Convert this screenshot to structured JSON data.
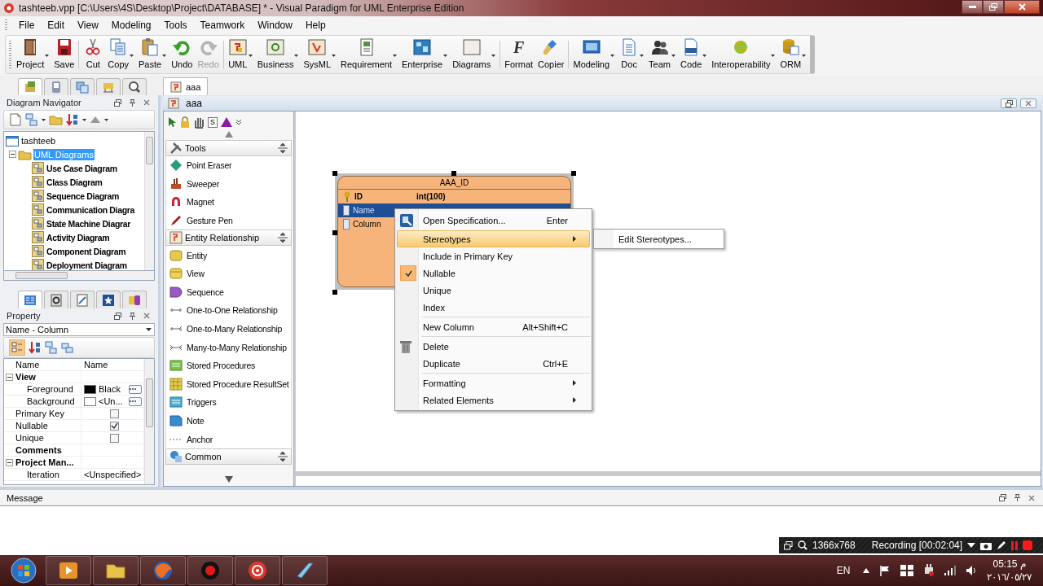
{
  "window": {
    "title": "tashteeb.vpp [C:\\Users\\4S\\Desktop\\Project\\DATABASE] * - Visual Paradigm for UML Enterprise Edition"
  },
  "menu": [
    "File",
    "Edit",
    "View",
    "Modeling",
    "Tools",
    "Teamwork",
    "Window",
    "Help"
  ],
  "toolbar": [
    {
      "kind": "button",
      "label": "Project",
      "dropdown": true,
      "disabled": false
    },
    {
      "kind": "button",
      "label": "Save",
      "dropdown": false,
      "disabled": false
    },
    {
      "kind": "separator"
    },
    {
      "kind": "button",
      "label": "Cut",
      "dropdown": false,
      "disabled": false
    },
    {
      "kind": "button",
      "label": "Copy",
      "dropdown": true,
      "disabled": false
    },
    {
      "kind": "button",
      "label": "Paste",
      "dropdown": true,
      "disabled": false
    },
    {
      "kind": "button",
      "label": "Undo",
      "dropdown": false,
      "disabled": false
    },
    {
      "kind": "button",
      "label": "Redo",
      "dropdown": false,
      "disabled": true
    },
    {
      "kind": "separator"
    },
    {
      "kind": "button",
      "label": "UML",
      "dropdown": true,
      "disabled": false
    },
    {
      "kind": "button",
      "label": "Business",
      "dropdown": true,
      "disabled": false
    },
    {
      "kind": "button",
      "label": "SysML",
      "dropdown": true,
      "disabled": false
    },
    {
      "kind": "button",
      "label": "Requirement",
      "dropdown": true,
      "disabled": false
    },
    {
      "kind": "button",
      "label": "Enterprise",
      "dropdown": true,
      "disabled": false
    },
    {
      "kind": "button",
      "label": "Diagrams",
      "dropdown": true,
      "disabled": false
    },
    {
      "kind": "separator"
    },
    {
      "kind": "button",
      "label": "Format",
      "glyph": "F",
      "dropdown": false,
      "disabled": false
    },
    {
      "kind": "button",
      "label": "Copier",
      "dropdown": false,
      "disabled": false
    },
    {
      "kind": "separator"
    },
    {
      "kind": "button",
      "label": "Modeling",
      "dropdown": true,
      "disabled": false
    },
    {
      "kind": "button",
      "label": "Doc",
      "dropdown": true,
      "disabled": false
    },
    {
      "kind": "button",
      "label": "Team",
      "dropdown": true,
      "disabled": false
    },
    {
      "kind": "button",
      "label": "Code",
      "dropdown": true,
      "disabled": false
    },
    {
      "kind": "button",
      "label": "Interoperability",
      "dropdown": true,
      "disabled": false
    },
    {
      "kind": "button",
      "label": "ORM",
      "dropdown": true,
      "disabled": false
    }
  ],
  "side_tabs": [
    {
      "selected": true
    },
    {
      "selected": false
    },
    {
      "selected": false
    },
    {
      "selected": false
    },
    {
      "selected": false
    }
  ],
  "document_tabs": [
    {
      "label": "aaa",
      "selected": true
    }
  ],
  "navigator": {
    "title": "Diagram Navigator",
    "tree": [
      {
        "label": "tashteeb",
        "selected": false,
        "children": [
          {
            "label": "UML Diagrams",
            "selected": true,
            "expanded": true,
            "children": [
              {
                "label": "Use Case Diagram",
                "selected": false
              },
              {
                "label": "Class Diagram",
                "selected": false
              },
              {
                "label": "Sequence Diagram",
                "selected": false
              },
              {
                "label": "Communication Diagra",
                "selected": false
              },
              {
                "label": "State Machine Diagrar",
                "selected": false
              },
              {
                "label": "Activity Diagram",
                "selected": false
              },
              {
                "label": "Component Diagram",
                "selected": false
              },
              {
                "label": "Deployment Diagram",
                "selected": false
              }
            ]
          }
        ]
      }
    ]
  },
  "bottom_tabs": [
    {
      "selected": true
    },
    {
      "selected": false
    },
    {
      "selected": false
    },
    {
      "selected": false
    },
    {
      "selected": false
    }
  ],
  "property": {
    "title": "Property",
    "selector": "Name - Column",
    "columns": [
      "Name",
      "Name"
    ],
    "rows": [
      {
        "kind": "group",
        "label": "View",
        "expanded": true,
        "children": [
          {
            "kind": "color",
            "label": "Foreground",
            "value": "Black",
            "color": "#000000"
          },
          {
            "kind": "color",
            "label": "Background",
            "value": "<Un...",
            "color": "#ffffff"
          }
        ]
      },
      {
        "kind": "checkbox",
        "label": "Primary Key",
        "checked": false
      },
      {
        "kind": "checkbox",
        "label": "Nullable",
        "checked": true
      },
      {
        "kind": "checkbox",
        "label": "Unique",
        "checked": false
      },
      {
        "kind": "heading",
        "label": "Comments"
      },
      {
        "kind": "group",
        "label": "Project Man...",
        "expanded": true,
        "children": [
          {
            "kind": "text",
            "label": "Iteration",
            "value": "<Unspecified>"
          }
        ]
      }
    ]
  },
  "diagram": {
    "title": "aaa"
  },
  "palette": {
    "tool_glyph": "S",
    "groups": [
      {
        "label": "Tools",
        "expanded": true,
        "items": [
          "Point Eraser",
          "Sweeper",
          "Magnet",
          "Gesture Pen"
        ]
      },
      {
        "label": "Entity Relationship",
        "expanded": true,
        "items": [
          "Entity",
          "View",
          "Sequence",
          "One-to-One Relationship",
          "One-to-Many Relationship",
          "Many-to-Many Relationship",
          "Stored Procedures",
          "Stored Procedure ResultSet",
          "Triggers",
          "Note",
          "Anchor"
        ]
      },
      {
        "label": "Common",
        "expanded": false
      }
    ]
  },
  "entity": {
    "name": "AAA_ID",
    "columns": [
      {
        "name": "ID",
        "type": "int(100)",
        "primary_key": true,
        "selected": false
      },
      {
        "name": "Name",
        "primary_key": false,
        "selected": true
      },
      {
        "name": "Column",
        "primary_key": false,
        "selected": false
      }
    ]
  },
  "context_menu": {
    "items": [
      {
        "kind": "item",
        "label": "Open Specification...",
        "shortcut": "Enter",
        "submenu": false,
        "selected": false,
        "checked": false
      },
      {
        "kind": "item",
        "label": "Stereotypes",
        "submenu": true,
        "selected": true,
        "checked": false
      },
      {
        "kind": "item",
        "label": "Include in Primary Key",
        "submenu": false,
        "selected": false,
        "checked": false
      },
      {
        "kind": "item",
        "label": "Nullable",
        "submenu": false,
        "selected": false,
        "checked": true
      },
      {
        "kind": "item",
        "label": "Unique",
        "submenu": false,
        "selected": false,
        "checked": false
      },
      {
        "kind": "item",
        "label": "Index",
        "submenu": false,
        "selected": false,
        "checked": false
      },
      {
        "kind": "separator"
      },
      {
        "kind": "item",
        "label": "New Column",
        "shortcut": "Alt+Shift+C",
        "submenu": false,
        "selected": false,
        "checked": false
      },
      {
        "kind": "separator"
      },
      {
        "kind": "item",
        "label": "Delete",
        "submenu": false,
        "selected": false,
        "checked": false
      },
      {
        "kind": "item",
        "label": "Duplicate",
        "shortcut": "Ctrl+E",
        "submenu": false,
        "selected": false,
        "checked": false
      },
      {
        "kind": "separator"
      },
      {
        "kind": "item",
        "label": "Formatting",
        "submenu": true,
        "selected": false,
        "checked": false
      },
      {
        "kind": "item",
        "label": "Related Elements",
        "submenu": true,
        "selected": false,
        "checked": false
      }
    ],
    "submenu": [
      "Edit Stereotypes..."
    ]
  },
  "message_panel": {
    "title": "Message"
  },
  "recorder": {
    "resolution": "1366x768",
    "status": "Recording [00:02:04]"
  },
  "taskbar": {
    "language": "EN",
    "time": "05:15 م",
    "date": "٢٠١٦/٠٥/٢٧"
  }
}
